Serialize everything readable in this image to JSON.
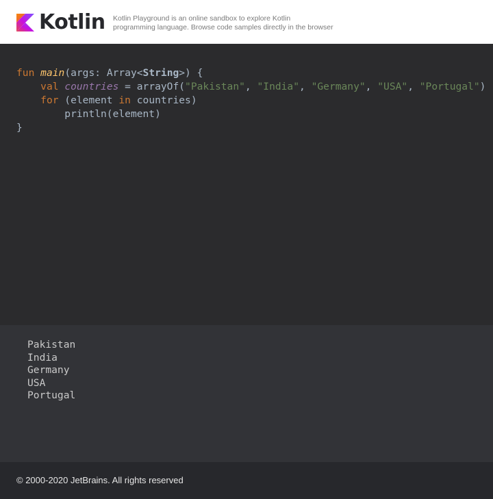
{
  "header": {
    "logo_text": "Kotlin",
    "tagline_line1": "Kotlin Playground is an online sandbox to explore Kotlin",
    "tagline_line2": "programming language. Browse code samples directly in the browser"
  },
  "code": {
    "fun_kw": "fun",
    "main_fn": "main",
    "args_part": "(args: Array<",
    "string_type": "String",
    "args_close": ">) {",
    "val_kw": "val",
    "countries_var": "countries",
    "arrayof_open": " = arrayOf(",
    "str_pakistan": "\"Pakistan\"",
    "str_india": "\"India\"",
    "str_germany": "\"Germany\"",
    "str_usa": "\"USA\"",
    "str_portugal": "\"Portugal\"",
    "comma": ", ",
    "close_paren": ")",
    "for_kw": "for",
    "for_open": " (element ",
    "in_kw": "in",
    "for_close": " countries)",
    "println_line": "println(element)",
    "close_brace": "}"
  },
  "output": {
    "lines": [
      "Pakistan",
      "India",
      "Germany",
      "USA",
      "Portugal"
    ]
  },
  "footer": {
    "copyright": "© 2000-2020 JetBrains. All rights reserved"
  },
  "colors": {
    "keyword": "#cc7832",
    "function": "#ffc66d",
    "variable": "#9876aa",
    "string": "#6a8759",
    "editor_bg": "#2b2b2d",
    "output_bg": "#323337",
    "footer_bg": "#27282c"
  },
  "icons": {
    "logo": "kotlin-logo-icon"
  }
}
